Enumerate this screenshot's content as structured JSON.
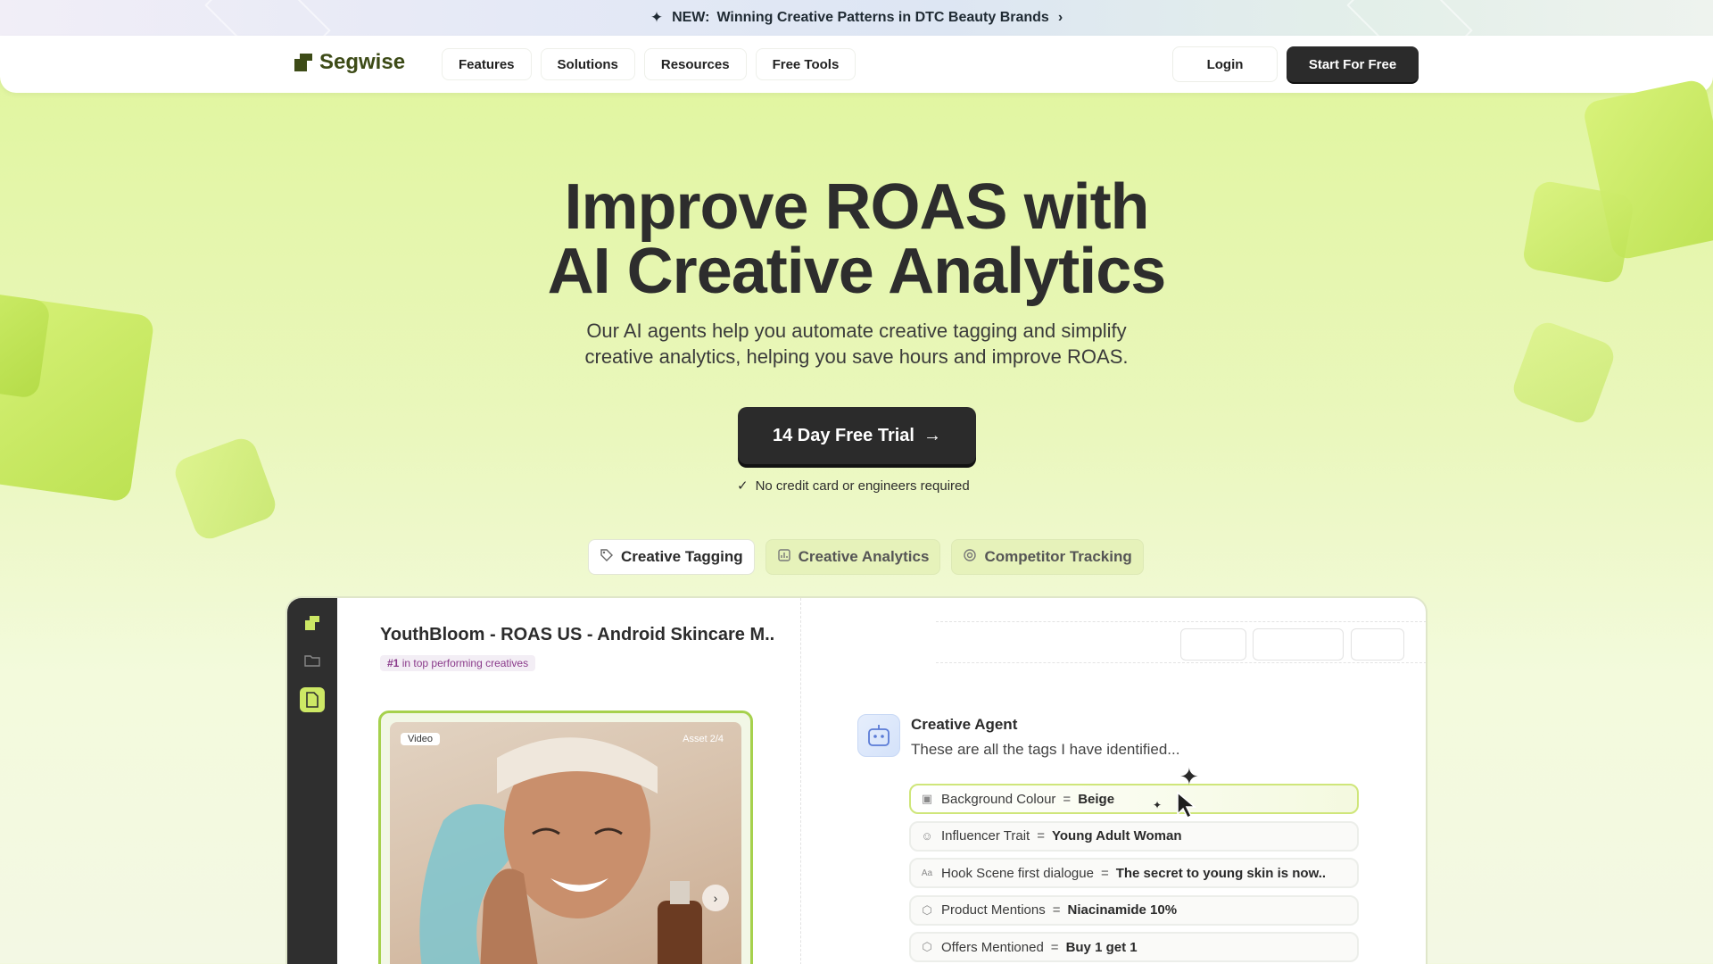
{
  "announcement": {
    "badge": "NEW:",
    "text": "Winning Creative Patterns in DTC Beauty Brands"
  },
  "nav": {
    "brand": "Segwise",
    "menu": [
      "Features",
      "Solutions",
      "Resources",
      "Free Tools"
    ],
    "login": "Login",
    "start": "Start For Free"
  },
  "hero": {
    "title_line1": "Improve ROAS with",
    "title_line2": "AI Creative Analytics",
    "subtitle_line1": "Our AI agents help you automate creative tagging and simplify",
    "subtitle_line2": "creative analytics, helping you save hours and improve ROAS.",
    "cta": "14 Day Free Trial",
    "note": "No credit card or engineers required"
  },
  "tabs": [
    {
      "label": "Creative Tagging",
      "icon": "tag-icon",
      "active": true
    },
    {
      "label": "Creative Analytics",
      "icon": "analytics-icon",
      "active": false
    },
    {
      "label": "Competitor Tracking",
      "icon": "target-icon",
      "active": false
    }
  ],
  "demo": {
    "project_title": "YouthBloom - ROAS US - Android Skincare M..",
    "rank_number": "#1",
    "rank_text": "in top performing creatives",
    "asset_type": "Video",
    "asset_counter": "Asset 2/4",
    "agent_name": "Creative Agent",
    "agent_message": "These are all the tags I have identified...",
    "tags": [
      {
        "key": "Background Colour",
        "value": "Beige",
        "icon": "image-icon"
      },
      {
        "key": "Influencer Trait",
        "value": "Young Adult Woman",
        "icon": "person-icon"
      },
      {
        "key": "Hook Scene first dialogue",
        "value": "The secret to young skin is now..",
        "icon": "text-icon"
      },
      {
        "key": "Product Mentions",
        "value": "Niacinamide 10%",
        "icon": "box-icon"
      },
      {
        "key": "Offers Mentioned",
        "value": "Buy 1 get 1",
        "icon": "box-icon"
      }
    ]
  },
  "colors": {
    "accent": "#cde865",
    "dark": "#2b2b2b",
    "brand": "#3d4b17"
  }
}
